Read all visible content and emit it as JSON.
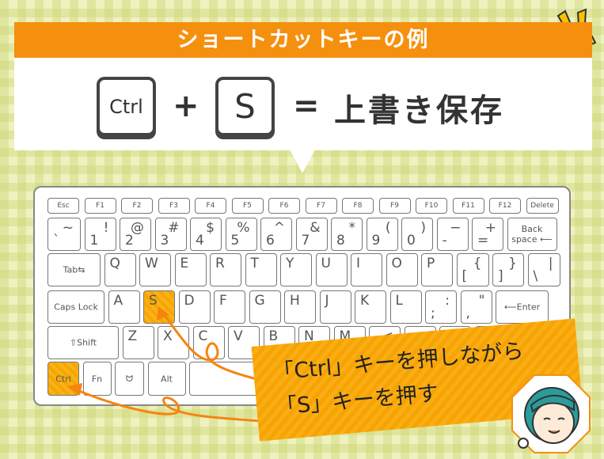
{
  "banner": {
    "title": "ショートカットキーの例"
  },
  "shortcut": {
    "key1": "Ctrl",
    "plus": "+",
    "key2": "S",
    "equals": "=",
    "result": "上書き保存"
  },
  "keyboard": {
    "rows": [
      [
        {
          "m": "Esc"
        },
        {
          "m": "F1"
        },
        {
          "m": "F2"
        },
        {
          "m": "F3"
        },
        {
          "m": "F4"
        },
        {
          "m": "F5"
        },
        {
          "m": "F6"
        },
        {
          "m": "F7"
        },
        {
          "m": "F8"
        },
        {
          "m": "F9"
        },
        {
          "m": "F10"
        },
        {
          "m": "F11"
        },
        {
          "m": "F12"
        },
        {
          "m": "Delete"
        }
      ],
      [
        {
          "t": "~",
          "b": "`"
        },
        {
          "t": "!",
          "b": "1"
        },
        {
          "t": "@",
          "b": "2"
        },
        {
          "t": "#",
          "b": "3"
        },
        {
          "t": "$",
          "b": "4"
        },
        {
          "t": "%",
          "b": "5"
        },
        {
          "t": "^",
          "b": "6"
        },
        {
          "t": "&",
          "b": "7"
        },
        {
          "t": "*",
          "b": "8"
        },
        {
          "t": "(",
          "b": "9"
        },
        {
          "t": ")",
          "b": "0"
        },
        {
          "t": "−",
          "b": "-"
        },
        {
          "t": "+",
          "b": "="
        },
        {
          "m": "Back space ⟵"
        }
      ],
      [
        {
          "m": "Tab⇆"
        },
        {
          "c": "Q"
        },
        {
          "c": "W"
        },
        {
          "c": "E"
        },
        {
          "c": "R"
        },
        {
          "c": "T"
        },
        {
          "c": "Y"
        },
        {
          "c": "U"
        },
        {
          "c": "I"
        },
        {
          "c": "O"
        },
        {
          "c": "P"
        },
        {
          "t": "{",
          "b": "["
        },
        {
          "t": "}",
          "b": "]"
        },
        {
          "t": "|",
          "b": "\\"
        }
      ],
      [
        {
          "m": "Caps Lock"
        },
        {
          "c": "A"
        },
        {
          "c": "S",
          "hl": true
        },
        {
          "c": "D"
        },
        {
          "c": "F"
        },
        {
          "c": "G"
        },
        {
          "c": "H"
        },
        {
          "c": "J"
        },
        {
          "c": "K"
        },
        {
          "c": "L"
        },
        {
          "t": ":",
          "b": ";"
        },
        {
          "t": "\"",
          "b": ","
        },
        {
          "m": "⟵Enter"
        }
      ],
      [
        {
          "m": "⇧Shift"
        },
        {
          "c": "Z"
        },
        {
          "c": "X"
        },
        {
          "c": "C"
        },
        {
          "c": "V"
        },
        {
          "c": "B"
        },
        {
          "c": "N"
        },
        {
          "c": "M"
        },
        {
          "t": "<"
        },
        {
          "t": ">"
        },
        {
          "t": "?"
        },
        {
          "m": ""
        }
      ],
      [
        {
          "m": "Ctrl",
          "hl": true
        },
        {
          "m": "Fn"
        },
        {
          "m": "ᗢ"
        },
        {
          "m": "Alt"
        },
        {
          "m": ""
        }
      ]
    ]
  },
  "callout": {
    "line1": "「Ctrl」キーを押しながら",
    "line2": "「S」キーを押す"
  },
  "colors": {
    "accent": "#f5900f",
    "highlight": "#f7a600",
    "background": "#eef2c0"
  }
}
